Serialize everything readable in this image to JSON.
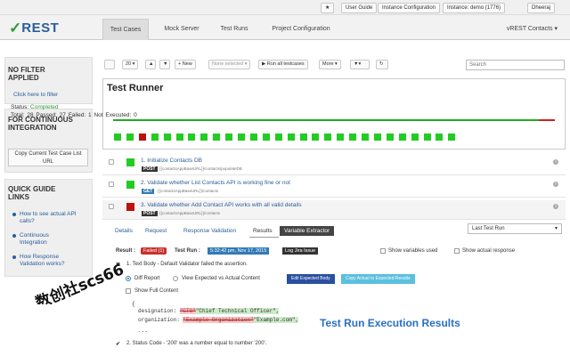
{
  "topbar": {
    "star": "★",
    "user_guide": "User Guide",
    "instance_config": "Instance Configuration",
    "instance": "Instance: demo (1776)",
    "user": "Dheeraj"
  },
  "header": {
    "logo_check": "✓",
    "logo_text": "REST",
    "tabs": [
      "Test Cases",
      "Mock Server",
      "Test Runs",
      "Project Configuration"
    ],
    "contacts": "vREST Contacts ▾"
  },
  "sidebar": {
    "no_filter_title": "NO FILTER APPLIED",
    "filter_link": "Click here to filter",
    "ci_title": "FOR CONTINUOUS INTEGRATION",
    "copy_button": "Copy Current Test Case List URL",
    "quick_title": "QUICK GUIDE LINKS",
    "links": [
      "How to see actual API calls?",
      "Continuous Integration",
      "How Response Validation works?"
    ]
  },
  "toolbar": {
    "page_size": "20 ▾",
    "new": "New",
    "none_selected": "None selected ▾",
    "run_all": "Run all testcases",
    "more": "More ▾",
    "search_placeholder": "Search"
  },
  "runner": {
    "title": "Test Runner",
    "status_label": "Status:",
    "status_value": "Completed",
    "stats": "Total: 28  Passed: 27  Failed: 1  Not Executed: 0"
  },
  "tests": [
    {
      "index": "1.",
      "title": "Initialize Contacts DB",
      "method": "POST",
      "url": "{{contactsAppBaseURL}}/contacts/populateDB",
      "color": "#22cc22"
    },
    {
      "index": "2.",
      "title": "Validate whether List Contacts API is working fine or not",
      "method": "GET",
      "url": "{{contactsAppBaseURL}}/contacts",
      "color": "#22cc22"
    },
    {
      "index": "3.",
      "title": "Validate whether Add Contact API works with all valid details",
      "method": "POST",
      "url": "{{contactsAppBaseURL}}/contacts",
      "color": "#bb1111"
    }
  ],
  "details": {
    "tabs": [
      "Details",
      "Request",
      "Response Validation",
      "Results",
      "Variable Extractor"
    ],
    "select": "Last Test Run",
    "result_label": "Result :",
    "result_badge": "Failed (1)",
    "test_run_label": "Test Run :",
    "test_run_value": "5:32:42 pm, Nov 17, 2015",
    "log_issue": "Log Jira Issue",
    "show_vars": "Show variables used",
    "show_actual": "Show actual response",
    "fail_mark": "✖",
    "assertion1": "1. Text Body - Default Validator failed the assertion.",
    "diff_report": "Diff Report",
    "view_expected": "View Expected vs Actual Content",
    "edit_expected": "Edit Expected Body",
    "copy_actual": "Copy Actual to Expected Results",
    "show_full": "Show Full Content",
    "brace_open": "{",
    "designation_key": "designation: ",
    "designation_old": "\"CTO\"",
    "designation_new": "\"Chief Technical Officer\",",
    "organization_key": "organization: ",
    "organization_old": "\"Example Organization\"",
    "organization_new": "\"Example.com\",",
    "ellipsis": "...",
    "pass_mark": "✔",
    "assertion2": "2. Status Code - '200' was a number equal to number '200'."
  },
  "caption": "Test Run Execution Results",
  "watermark_text": "数创社scs66",
  "colors": {
    "accent": "#2a5d9a",
    "pass": "#22cc22",
    "fail": "#bb1111",
    "caption": "#2a6fc4"
  }
}
